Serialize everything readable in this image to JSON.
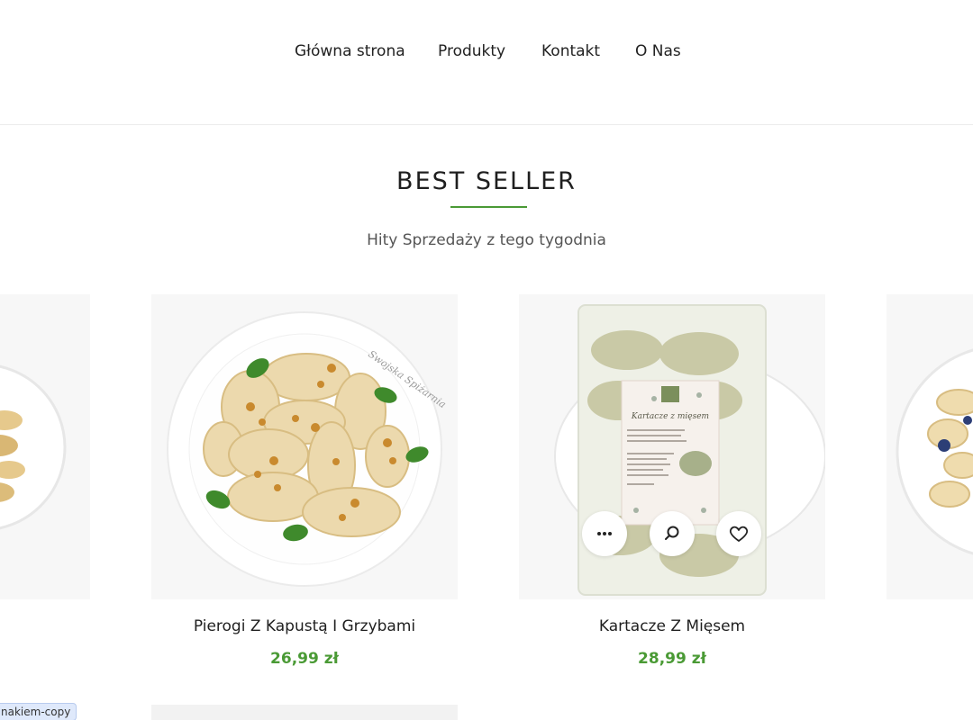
{
  "nav": {
    "items": [
      {
        "label": "Główna strona"
      },
      {
        "label": "Produkty"
      },
      {
        "label": "Kontakt"
      },
      {
        "label": "O Nas"
      }
    ]
  },
  "section": {
    "title": "BEST SELLER",
    "subtitle": "Hity Sprzedaży z tego tygodnia"
  },
  "products": [
    {
      "title": "Pierogi Z Kapustą I Grzybami",
      "price": "26,99 zł",
      "plate_text": "Swojska Spiżarnia"
    },
    {
      "title": "Kartacze Z Mięsem",
      "price": "28,99 zł",
      "package_label": "Kartacze z mięsem"
    }
  ],
  "actions": {
    "more": "more-icon",
    "search": "search-icon",
    "wishlist": "heart-icon"
  },
  "tooltip": {
    "text": "nakiem-copy"
  },
  "colors": {
    "accent": "#4a9a35",
    "text": "#222222"
  }
}
